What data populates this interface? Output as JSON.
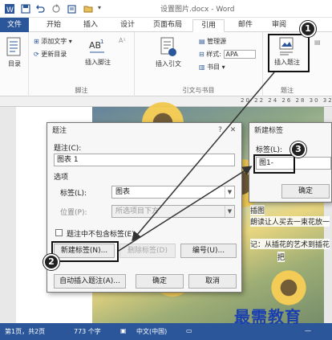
{
  "window": {
    "title": "设置图片.docx - Word"
  },
  "tabs": [
    "文件",
    "开始",
    "插入",
    "设计",
    "页面布局",
    "引用",
    "邮件",
    "审阅"
  ],
  "ribbon": {
    "toc": {
      "label": "目录",
      "group": "目录"
    },
    "footnote": {
      "add_text": "添加文字",
      "update_toc": "更新目录",
      "insert_footnote": "插入脚注",
      "group": "脚注"
    },
    "citations": {
      "insert_citation": "插入引文",
      "manage_sources": "管理源",
      "style_label": "样式:",
      "style_value": "APA",
      "bibliography": "书目",
      "group": "引文与书目"
    },
    "captions": {
      "insert_caption": "插入题注",
      "group": "题注"
    }
  },
  "ruler": {
    "numbers": "20 22 24 26 28 30 32"
  },
  "document": {
    "line1": "插图",
    "line2": "朗读让人买去一束花放一",
    "line3": "记：从插花的艺术到插花",
    "line4": "把"
  },
  "caption_dialog": {
    "title": "题注",
    "caption_label": "题注(C):",
    "caption_value": "图表 1",
    "options_label": "选项",
    "label_label": "标签(L):",
    "label_value": "图表",
    "position_label": "位置(P):",
    "position_value": "所选项目下方",
    "exclude_label_text": "题注中不包含标签(E)",
    "new_label_button": "新建标签(N)...",
    "delete_label_button": "删除标签(D)",
    "numbering_button": "编号(U)...",
    "auto_caption_button": "自动插入题注(A)...",
    "ok_button": "确定",
    "cancel_button": "取消"
  },
  "new_label_dialog": {
    "title": "新建标签",
    "label_label": "标签(L):",
    "label_value": "图1-",
    "ok_button": "确定"
  },
  "markers": [
    "1",
    "2",
    "3"
  ],
  "status_bar": {
    "page": "第1页，共2页",
    "words": "773 个字",
    "language": "中文(中国)",
    "zoom": "—"
  },
  "watermark": "最需教育",
  "icons": {
    "save": "save-icon",
    "undo": "undo-icon",
    "redo": "redo-icon",
    "close": "close-icon",
    "help": "help-icon",
    "dropdown": "chevron-down-icon"
  },
  "colors": {
    "word_blue": "#2b579a",
    "watermark": "#1a3fb0"
  }
}
